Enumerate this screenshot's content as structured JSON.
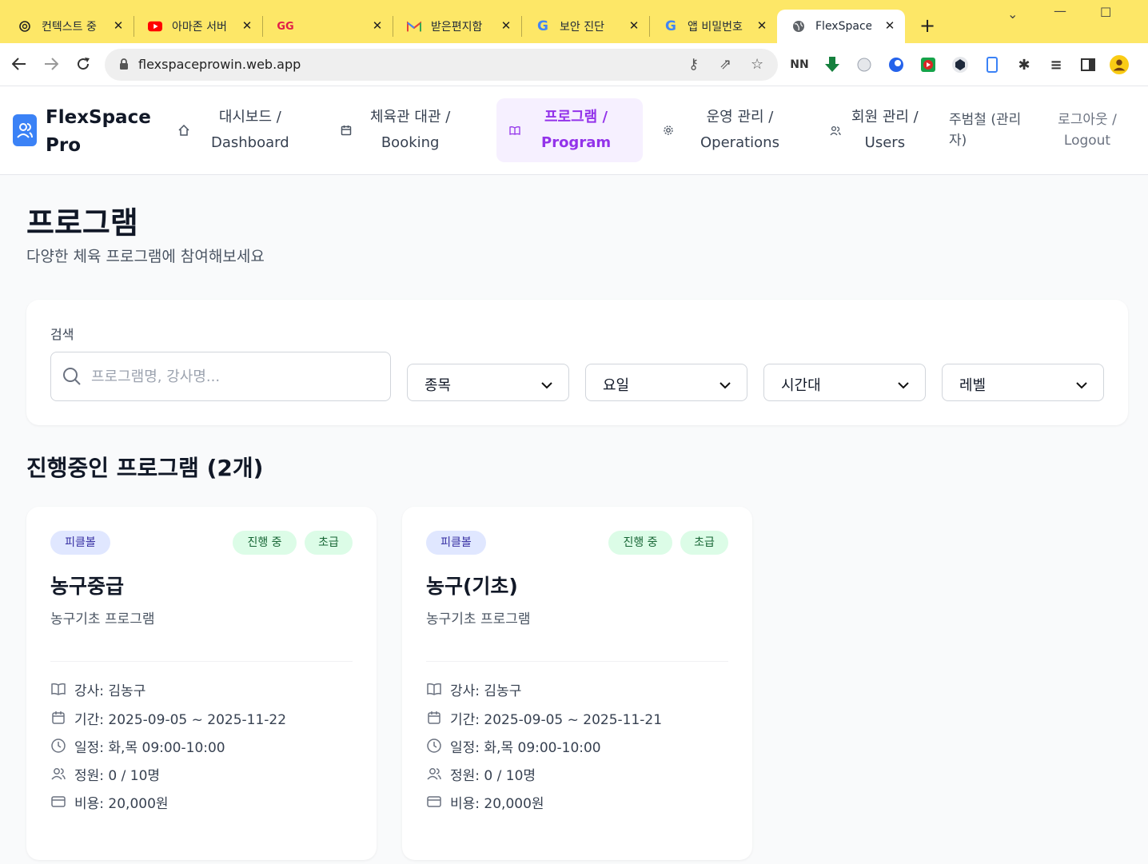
{
  "browser": {
    "tabs": [
      {
        "title": "컨텍스트 중",
        "icon": "openai-icon"
      },
      {
        "title": "아마존 서버",
        "icon": "youtube-icon"
      },
      {
        "title": "",
        "icon": "gg-logo-icon"
      },
      {
        "title": "받은편지함",
        "icon": "gmail-icon"
      },
      {
        "title": "보안 진단",
        "icon": "google-icon"
      },
      {
        "title": "앱 비밀번호",
        "icon": "google-icon"
      },
      {
        "title": "FlexSpace P",
        "icon": "globe-icon"
      }
    ],
    "url": "flexspaceprowin.web.app",
    "accent": "#fde767"
  },
  "app": {
    "brand": "FlexSpace Pro",
    "nav": [
      {
        "label": "대시보드 /\nDashboard",
        "icon": "home-icon"
      },
      {
        "label": "체육관 대관 /\nBooking",
        "icon": "calendar-icon"
      },
      {
        "label": "프로그램 /\nProgram",
        "icon": "book-icon",
        "active": true
      },
      {
        "label": "운영 관리 /\nOperations",
        "icon": "gear-icon"
      },
      {
        "label": "회원 관리 /\nUsers",
        "icon": "users-icon"
      }
    ],
    "user": "주범철 (관리자)",
    "logout": "로그아웃 / Logout",
    "accent": "#9333ea",
    "brand_color": "#3b82f6"
  },
  "page": {
    "title": "프로그램",
    "subtitle": "다양한 체육 프로그램에 참여해보세요"
  },
  "filters": {
    "search_label": "검색",
    "search_placeholder": "프로그램명, 강사명...",
    "selects": [
      "종목",
      "요일",
      "시간대",
      "레벨"
    ]
  },
  "section": {
    "title": "진행중인 프로그램 (2개)"
  },
  "programs": [
    {
      "sport": "피클볼",
      "status": "진행 중",
      "level": "초급",
      "title": "농구중급",
      "description": "농구기초 프로그램",
      "instructor": "강사: 김농구",
      "period": "기간: 2025-09-05 ~ 2025-11-22",
      "schedule": "일정: 화,목 09:00-10:00",
      "capacity": "정원: 0 / 10명",
      "fee": "비용: 20,000원"
    },
    {
      "sport": "피클볼",
      "status": "진행 중",
      "level": "초급",
      "title": "농구(기초)",
      "description": "농구기초 프로그램",
      "instructor": "강사: 김농구",
      "period": "기간: 2025-09-05 ~ 2025-11-21",
      "schedule": "일정: 화,목 09:00-10:00",
      "capacity": "정원: 0 / 10명",
      "fee": "비용: 20,000원"
    }
  ]
}
